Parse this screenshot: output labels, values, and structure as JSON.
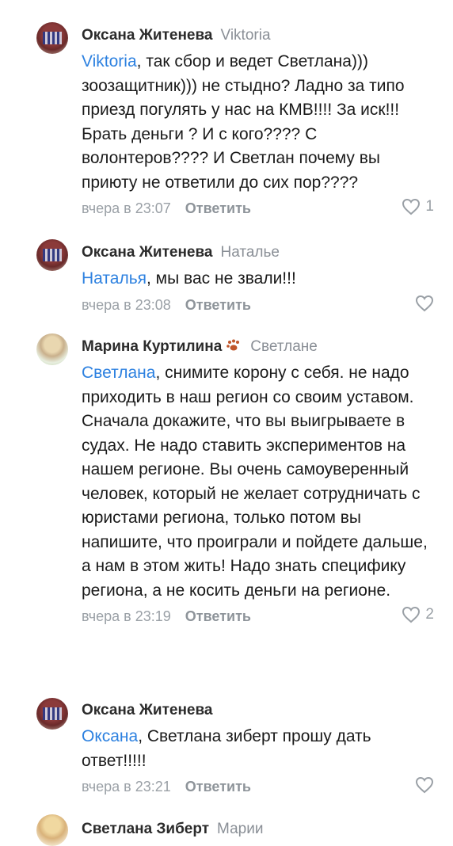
{
  "comments": [
    {
      "author": "Оксана Житенева",
      "reply_to": "Viktoria",
      "mention": "Viktoria",
      "text": ", так сбор и ведет Светлана))) зоозащитник))) не стыдно? Ладно за типо приезд погулять у нас на КМВ!!!! За иск!!! Брать деньги ? И с кого???? С волонтеров???? И Светлан почему вы приюту не ответили до сих пор????",
      "time": "вчера в 23:07",
      "reply_label": "Ответить",
      "likes": "1"
    },
    {
      "author": "Оксана Житенева",
      "reply_to": "Наталье",
      "mention": "Наталья",
      "text": ", мы вас не звали!!!",
      "time": "вчера в 23:08",
      "reply_label": "Ответить",
      "likes": ""
    },
    {
      "author": "Марина Куртилина",
      "reply_to": "Светлане",
      "mention": "Светлана",
      "text": ", снимите корону с себя. не надо приходить в наш регион со своим уставом. Сначала докажите, что вы выигрываете в судах. Не надо ставить экспериментов на нашем регионе. Вы очень самоуверенный человек, который не желает сотрудничать с юристами региона, только потом вы напишите, что проиграли и пойдете дальше, а нам в этом жить! Надо знать специфику региона, а не косить деньги на регионе.",
      "time": "вчера в 23:19",
      "reply_label": "Ответить",
      "likes": "2"
    },
    {
      "author": "Оксана Житенева",
      "reply_to": "",
      "mention": "Оксана",
      "text": ", Светлана зиберт прошу дать ответ!!!!!",
      "time": "вчера в 23:21",
      "reply_label": "Ответить",
      "likes": ""
    },
    {
      "author": "Светлана Зиберт",
      "reply_to": "Марии"
    }
  ],
  "colors": {
    "mention": "#2d81e0",
    "meta": "#9aa0a6",
    "author": "#2b2b2b"
  }
}
